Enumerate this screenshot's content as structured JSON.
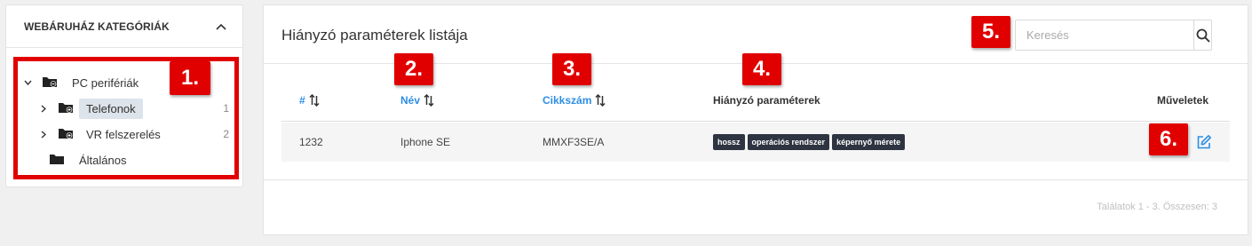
{
  "sidebar": {
    "title": "WEBÁRUHÁZ KATEGÓRIÁK",
    "items": [
      {
        "label": "PC perifériák",
        "count": ""
      },
      {
        "label": "Telefonok",
        "count": "1"
      },
      {
        "label": "VR felszerelés",
        "count": "2"
      },
      {
        "label": "Általános",
        "count": ""
      }
    ]
  },
  "main": {
    "title": "Hiányzó paraméterek listája",
    "search": {
      "placeholder": "Keresés",
      "value": ""
    },
    "columns": {
      "id": "#",
      "name": "Név",
      "sku": "Cikkszám",
      "missing": "Hiányzó paraméterek",
      "actions": "Műveletek"
    },
    "rows": [
      {
        "id": "1232",
        "name": "Iphone SE",
        "sku": "MMXF3SE/A",
        "tags": [
          "hossz",
          "operációs rendszer",
          "képernyő mérete"
        ]
      }
    ],
    "pagination": "Találatok 1 - 3. Összesen: 3"
  },
  "annotations": [
    "1.",
    "2.",
    "3.",
    "4.",
    "5.",
    "6."
  ],
  "colors": {
    "accent": "#2d8ee3",
    "annotation": "#e10000",
    "tag_bg": "#2e3441",
    "selected_bg": "#dde3ea"
  }
}
